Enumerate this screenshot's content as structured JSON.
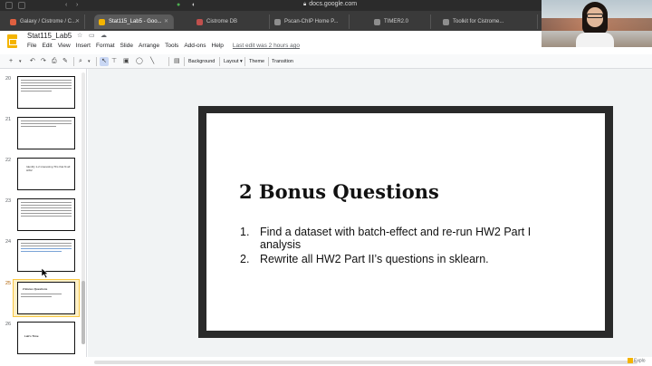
{
  "browser": {
    "address": "docs.google.com",
    "tabs": [
      {
        "label": "Galaxy / Cistrome / C...",
        "fav_color": "#e06040"
      },
      {
        "label": "Stat115_Lab5 - Goo...",
        "fav_color": "#f4b400",
        "active": true
      },
      {
        "label": "Cistrome DB",
        "fav_color": "#c0504d"
      },
      {
        "label": "Pscan-ChIP Home P...",
        "fav_color": "#8e8e8e"
      },
      {
        "label": "TIMER2.0",
        "fav_color": "#8e8e8e"
      },
      {
        "label": "Toolkit for Cistrome...",
        "fav_color": "#8e8e8e"
      }
    ]
  },
  "docs": {
    "title": "Stat115_Lab5",
    "menu": [
      "File",
      "Edit",
      "View",
      "Insert",
      "Format",
      "Slide",
      "Arrange",
      "Tools",
      "Add-ons",
      "Help"
    ],
    "last_edit": "Last edit was 2 hours ago"
  },
  "toolbar": {
    "background": "Background",
    "layout": "Layout",
    "theme": "Theme",
    "transition": "Transition"
  },
  "filmstrip": {
    "slides": [
      {
        "number": "20",
        "text": ""
      },
      {
        "number": "21",
        "text": ""
      },
      {
        "number": "22",
        "text": "Identify 1-2 interesting TFs that fit all HW2"
      },
      {
        "number": "23",
        "text": ""
      },
      {
        "number": "24",
        "text": ""
      },
      {
        "number": "25",
        "text": "2 Bonus Questions",
        "selected": true
      },
      {
        "number": "26",
        "text": "Lab's Time"
      }
    ]
  },
  "slide": {
    "title": "2 Bonus Questions",
    "items": [
      {
        "num": "1.",
        "text": "Find a dataset with batch-effect and re-run HW2 Part I analysis"
      },
      {
        "num": "2.",
        "text": "Rewrite all HW2 Part II’s questions in sklearn."
      }
    ]
  },
  "explore_label": "Explo"
}
